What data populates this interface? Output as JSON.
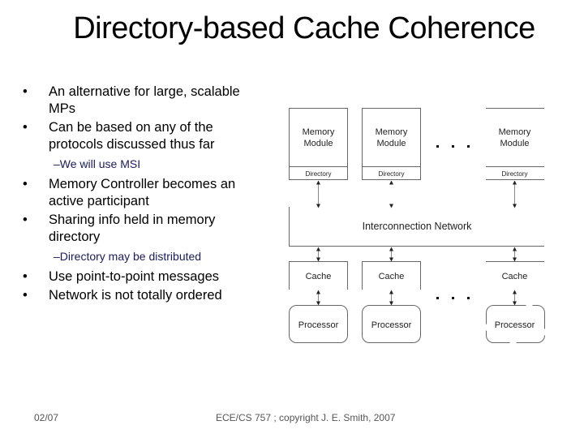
{
  "slide": {
    "title": "Directory-based Cache Coherence",
    "bullets": [
      {
        "text": "An alternative for large, scalable MPs",
        "lines": [
          "An alternative for large, scalable",
          "MPs"
        ]
      },
      {
        "text": "Can be based on any of the protocols discussed thus far",
        "lines": [
          "Can be based on any of the",
          "protocols discussed thus far"
        ],
        "sub": "–We will use MSI"
      },
      {
        "text": "Memory Controller becomes an active participant",
        "lines": [
          "Memory Controller becomes an",
          "active participant"
        ]
      },
      {
        "text": "Sharing info held in memory directory",
        "lines": [
          "Sharing info held in memory",
          "directory"
        ],
        "sub": "–Directory may be distributed"
      },
      {
        "text": "Use point-to-point messages",
        "lines": [
          "Use point-to-point messages"
        ]
      },
      {
        "text": "Network is not totally ordered",
        "lines": [
          "Network is not totally ordered"
        ]
      }
    ],
    "bullet_glyph": "•",
    "footer": {
      "date": "02/07",
      "copyright": "ECE/CS 757 ; copyright J. E. Smith, 2007"
    }
  },
  "diagram": {
    "memory_modules": [
      {
        "label_line1": "Memory",
        "label_line2": "Module",
        "directory": "Directory"
      },
      {
        "label_line1": "Memory",
        "label_line2": "Module",
        "directory": "Directory"
      },
      {
        "label_line1": "Memory",
        "label_line2": "Module",
        "directory": "Directory"
      }
    ],
    "network_label": "Interconnection Network",
    "caches": [
      "Cache",
      "Cache",
      "Cache"
    ],
    "processors": [
      "Processor",
      "Processor",
      "Processor"
    ],
    "ellipsis": "▪  ▪  ▪"
  }
}
